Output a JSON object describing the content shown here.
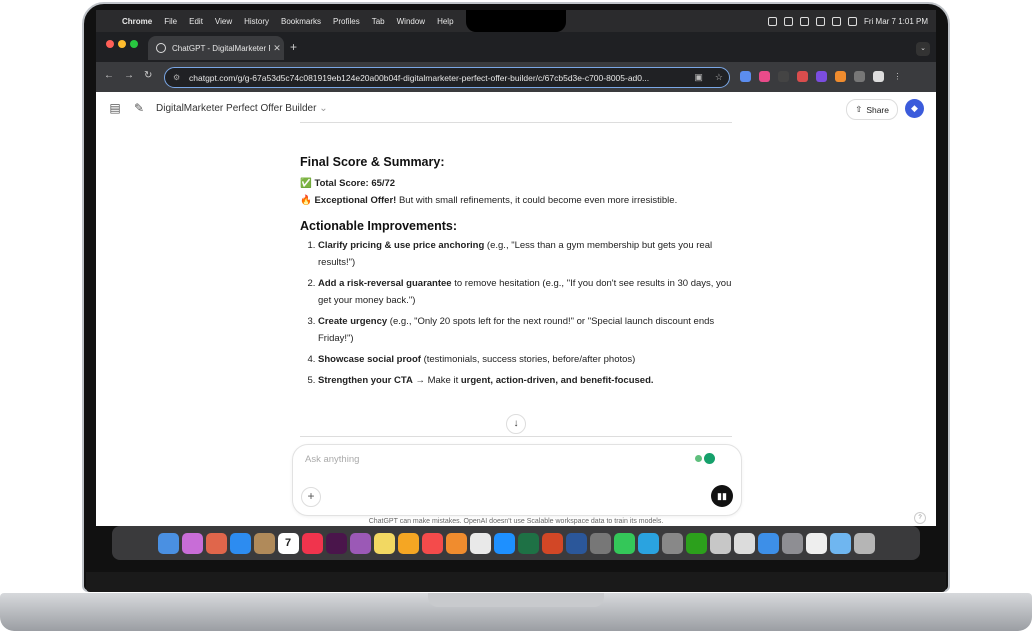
{
  "menubar": {
    "app": "Chrome",
    "items": [
      "File",
      "Edit",
      "View",
      "History",
      "Bookmarks",
      "Profiles",
      "Tab",
      "Window",
      "Help"
    ],
    "datetime": "Fri Mar 7  1:01 PM"
  },
  "browser": {
    "tab_title": "ChatGPT - DigitalMarketer Pe",
    "url": "chatgpt.com/g/g-67a53d5c74c081919eb124e20a00b04f-digitalmarketer-perfect-offer-builder/c/67cb5d3e-c700-8005-ad0..."
  },
  "app": {
    "title": "DigitalMarketer Perfect Offer Builder",
    "share_label": "Share"
  },
  "chat": {
    "summary_heading": "Final Score & Summary:",
    "score_emoji": "✅",
    "score_text": "Total Score: 65/72",
    "verdict_emoji": "🔥",
    "verdict_bold": "Exceptional Offer!",
    "verdict_rest": " But with small refinements, it could become even more irresistible.",
    "improvements_heading": "Actionable Improvements:",
    "improvements": [
      {
        "bold": "Clarify pricing & use price anchoring",
        "rest": " (e.g., \"Less than a gym membership but gets you real results!\")"
      },
      {
        "bold": "Add a risk-reversal guarantee",
        "rest": " to remove hesitation (e.g., \"If you don't see results in 30 days, you get your money back.\")"
      },
      {
        "bold": "Create urgency",
        "rest": " (e.g., \"Only 20 spots left for the next round!\" or \"Special launch discount ends Friday!\")"
      },
      {
        "bold": "Showcase social proof",
        "rest": " (testimonials, success stories, before/after photos)"
      },
      {
        "bold": "Strengthen your CTA",
        "rest": " → Make it ",
        "bold2": "urgent, action-driven, and benefit-focused."
      }
    ]
  },
  "composer": {
    "placeholder": "Ask anything"
  },
  "footer": {
    "disclaimer": "ChatGPT can make mistakes. OpenAI doesn't use Scalable workspace data to train its models.",
    "help": "?"
  },
  "colors": {
    "accent": "#3b5bdb",
    "focus_ring": "#7aa7e6"
  },
  "dock_apps": [
    "finder",
    "launchpad",
    "apps",
    "safari",
    "notes-app",
    "calendar",
    "music",
    "slack",
    "podcasts",
    "stickies",
    "photos",
    "news",
    "books",
    "chrome",
    "app-store",
    "excel",
    "powerpoint",
    "word",
    "calculator",
    "messages",
    "telegram",
    "whatsapp",
    "quickbooks",
    "keynote",
    "chatgpt",
    "preview",
    "settings",
    "scanner",
    "folder",
    "trash"
  ],
  "dock_calendar_day": "7"
}
